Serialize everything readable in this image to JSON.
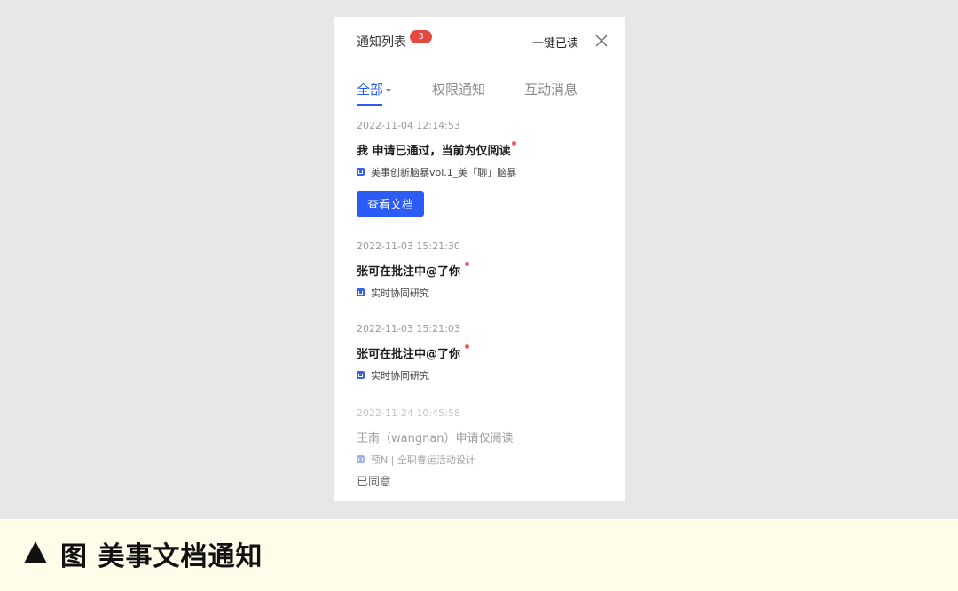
{
  "header": {
    "title": "通知列表",
    "unread_badge": "3",
    "mark_all_read": "一键已读"
  },
  "tabs": [
    {
      "label": "全部",
      "active": true
    },
    {
      "label": "权限通知",
      "active": false
    },
    {
      "label": "互动消息",
      "active": false
    }
  ],
  "notifications": [
    {
      "timestamp": "2022-11-04 12:14:53",
      "message": "我 申请已通过，当前为仅阅读",
      "doc": "美事创新脑暴vol.1_美「聊」脑暴",
      "action_label": "查看文档"
    },
    {
      "timestamp": "2022-11-03 15:21:30",
      "message": "张可在批注中@了你",
      "doc": "实时协同研究"
    },
    {
      "timestamp": "2022-11-03 15:21:03",
      "message": "张可在批注中@了你",
      "doc": "实时协同研究"
    },
    {
      "timestamp": "2022-11-24 10:45:58",
      "message": "王南（wangnan）申请仅阅读",
      "doc": "预N | 全职春运活动设计",
      "status": "已同意"
    }
  ],
  "caption": {
    "text": "图 美事文档通知"
  },
  "colors": {
    "accent": "#2b5cf6",
    "badge": "#e5483f",
    "caption_background": "#fffcea",
    "page_background": "#e7e7e7"
  }
}
